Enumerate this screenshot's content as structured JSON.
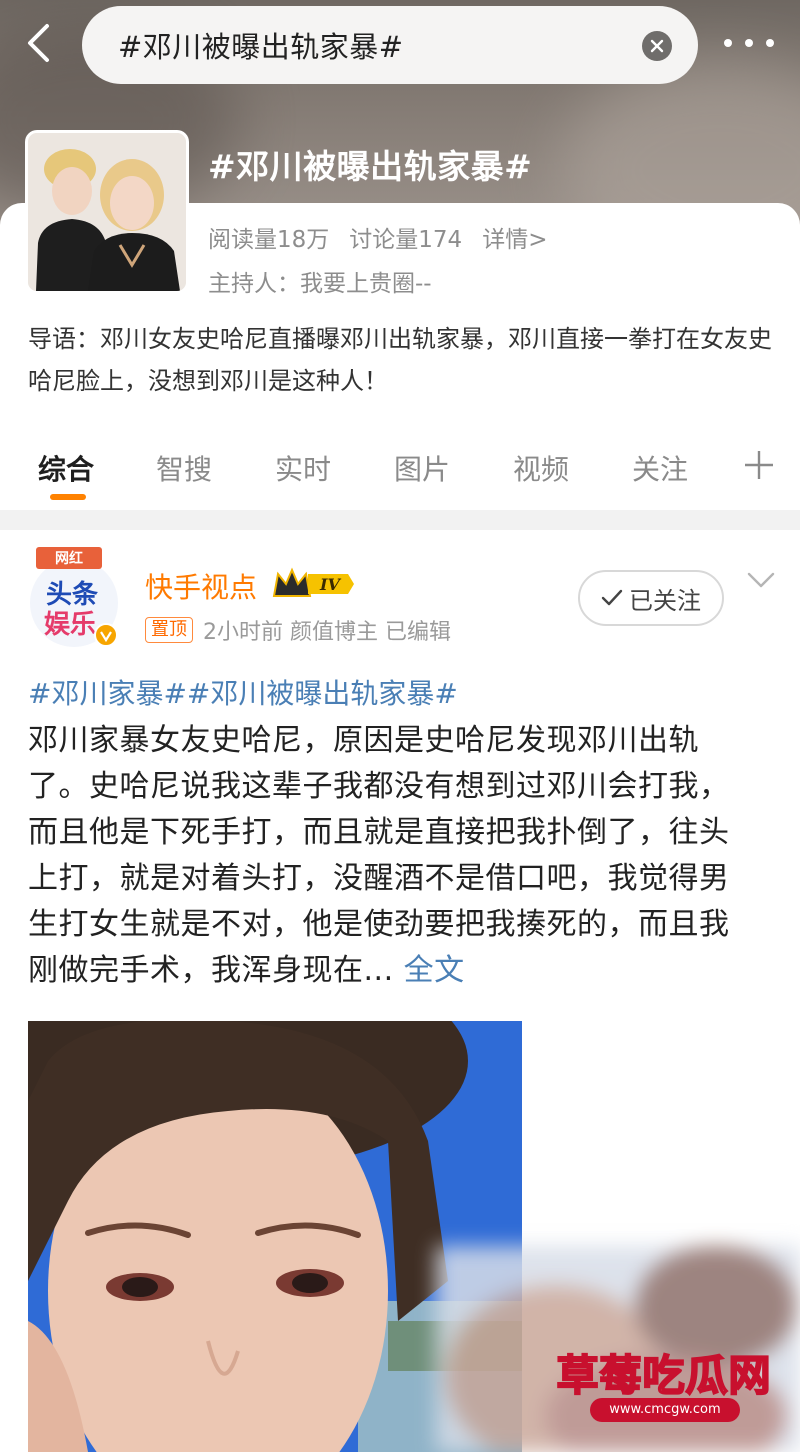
{
  "header": {
    "search_text": "#邓川被曝出轨家暴#",
    "topic_title": "#邓川被曝出轨家暴#"
  },
  "topic": {
    "reads": "阅读量18万",
    "discussions": "讨论量174",
    "details": "详情>",
    "host": "主持人：我要上贵圈--",
    "intro": "导语：邓川女友史哈尼直播曝邓川出轨家暴，邓川直接一拳打在女友史哈尼脸上，没想到邓川是这种人！"
  },
  "tabs": [
    {
      "label": "综合",
      "active": true
    },
    {
      "label": "智搜"
    },
    {
      "label": "实时"
    },
    {
      "label": "图片"
    },
    {
      "label": "视频"
    },
    {
      "label": "关注"
    }
  ],
  "post": {
    "avatar_text_top": "网红",
    "avatar_text_1": "头条",
    "avatar_text_2": "娱乐",
    "author": "快手视点",
    "vip_level": "IV",
    "pinned": "置顶",
    "meta": "2小时前  颜值博主  已编辑",
    "follow_label": "已关注",
    "tags": "#邓川家暴##邓川被曝出轨家暴#",
    "body": "邓川家暴女友史哈尼，原因是史哈尼发现邓川出轨了。史哈尼说我这辈子我都没有想到过邓川会打我，而且他是下死手打，而且就是直接把我扑倒了，往头上打，就是对着头打，没醒酒不是借口吧，我觉得男生打女生就是不对，他是使劲要把我揍死的，而且我刚做完手术，我浑身现在...",
    "more_link": "全文"
  },
  "watermark": {
    "name": "草莓吃瓜网",
    "url": "www.cmcgw.com"
  },
  "colors": {
    "accent": "#ff8200",
    "link": "#4a7fb5",
    "author": "#ff7a00"
  }
}
